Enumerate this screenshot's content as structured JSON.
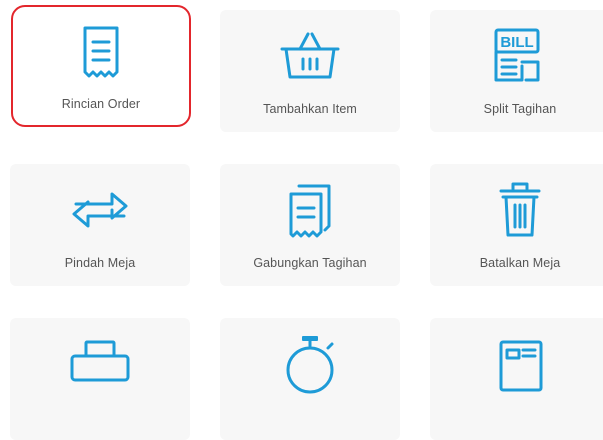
{
  "accent_color": "#1e9bd7",
  "selection_color": "#e3262c",
  "menu": {
    "items": [
      {
        "label": "Rincian Order",
        "icon": "receipt-icon",
        "selected": true
      },
      {
        "label": "Tambahkan Item",
        "icon": "basket-icon",
        "selected": false
      },
      {
        "label": "Split Tagihan",
        "icon": "split-bill-icon",
        "selected": false
      },
      {
        "label": "Pindah Meja",
        "icon": "swap-arrows-icon",
        "selected": false
      },
      {
        "label": "Gabungkan Tagihan",
        "icon": "merge-receipts-icon",
        "selected": false
      },
      {
        "label": "Batalkan Meja",
        "icon": "trash-icon",
        "selected": false
      },
      {
        "label": "",
        "icon": "printer-icon",
        "selected": false
      },
      {
        "label": "",
        "icon": "stopwatch-icon",
        "selected": false
      },
      {
        "label": "",
        "icon": "document-icon",
        "selected": false
      }
    ],
    "bill_badge_text": "BILL"
  }
}
